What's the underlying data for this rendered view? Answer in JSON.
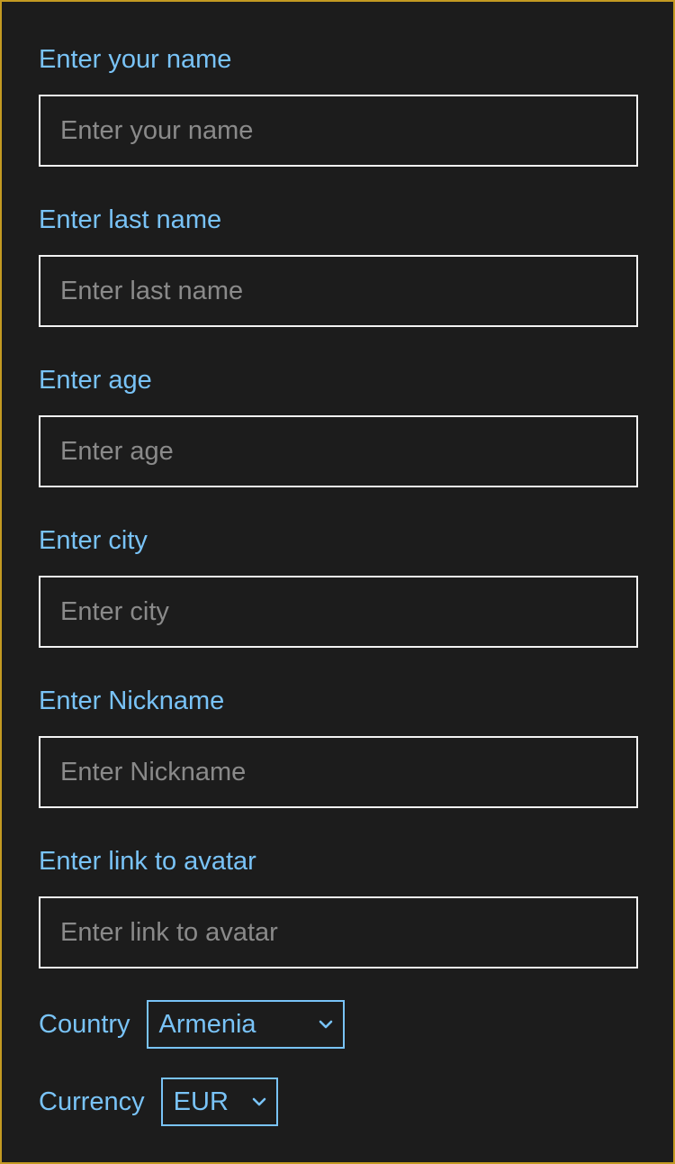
{
  "form": {
    "fields": [
      {
        "label": "Enter your name",
        "placeholder": "Enter your name",
        "value": ""
      },
      {
        "label": "Enter last name",
        "placeholder": "Enter last name",
        "value": ""
      },
      {
        "label": "Enter age",
        "placeholder": "Enter age",
        "value": ""
      },
      {
        "label": "Enter city",
        "placeholder": "Enter city",
        "value": ""
      },
      {
        "label": "Enter Nickname",
        "placeholder": "Enter Nickname",
        "value": ""
      },
      {
        "label": "Enter link to avatar",
        "placeholder": "Enter link to avatar",
        "value": ""
      }
    ],
    "country": {
      "label": "Country",
      "selected": "Armenia"
    },
    "currency": {
      "label": "Currency",
      "selected": "EUR"
    }
  },
  "colors": {
    "background": "#1c1c1c",
    "label": "#79c3f7",
    "input_border": "#f2f2f2",
    "placeholder": "#8a8a8a",
    "frame_border": "#c39a22"
  },
  "icons": {
    "select_arrow": "chevron-down-icon"
  }
}
